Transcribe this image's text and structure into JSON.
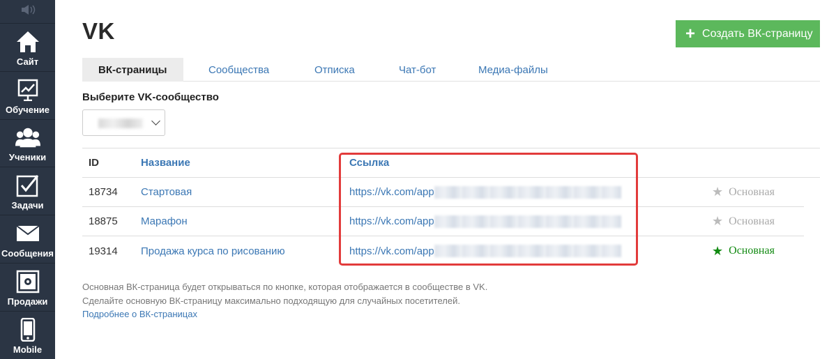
{
  "sidebar": {
    "top_icon": "speaker-icon",
    "items": [
      {
        "label": "Сайт",
        "icon": "house-icon"
      },
      {
        "label": "Обучение",
        "icon": "chart-board-icon"
      },
      {
        "label": "Ученики",
        "icon": "users-icon"
      },
      {
        "label": "Задачи",
        "icon": "checkbox-icon"
      },
      {
        "label": "Сообщения",
        "icon": "envelope-icon"
      },
      {
        "label": "Продажи",
        "icon": "safe-icon"
      },
      {
        "label": "Mobile",
        "icon": "phone-icon"
      }
    ]
  },
  "page": {
    "title": "VK",
    "create_button": "Создать ВК-страницу"
  },
  "tabs": [
    {
      "label": "ВК-страницы",
      "active": true
    },
    {
      "label": "Сообщества",
      "active": false
    },
    {
      "label": "Отписка",
      "active": false
    },
    {
      "label": "Чат-бот",
      "active": false
    },
    {
      "label": "Медиа-файлы",
      "active": false
    }
  ],
  "community_select": {
    "label": "Выберите VK-сообщество"
  },
  "table": {
    "headers": {
      "id": "ID",
      "name": "Название",
      "link": "Ссылка"
    },
    "rows": [
      {
        "id": "18734",
        "name": "Стартовая",
        "link": "https://vk.com/app",
        "main_label": "Основная",
        "is_main": false
      },
      {
        "id": "18875",
        "name": "Марафон",
        "link": "https://vk.com/app",
        "main_label": "Основная",
        "is_main": false
      },
      {
        "id": "19314",
        "name": "Продажа курса по рисованию",
        "link": "https://vk.com/app",
        "main_label": "Основная",
        "is_main": true
      }
    ]
  },
  "note": {
    "line1": "Основная ВК-страница будет открываться по кнопке, которая отображается в сообществе в VK.",
    "line2": "Сделайте основную ВК-страницу максимально подходящую для случайных посетителей.",
    "link": "Подробнее о ВК-страницах"
  },
  "colors": {
    "sidebar_bg": "#2b3544",
    "accent_green": "#5cb85c",
    "link_blue": "#3b77b4",
    "highlight_red": "#e23b3b",
    "main_star_green": "#128a12"
  }
}
